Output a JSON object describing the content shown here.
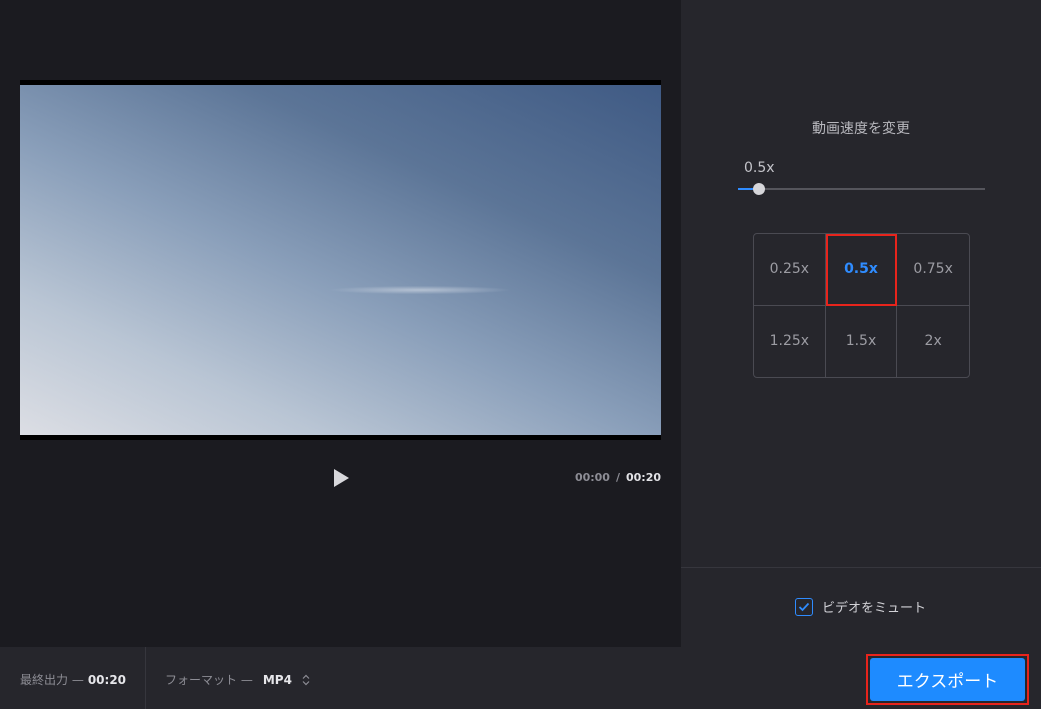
{
  "player": {
    "current_time": "00:00",
    "separator": "/",
    "duration": "00:20",
    "play_icon": "play-icon"
  },
  "speed": {
    "title": "動画速度を変更",
    "slider_value": "0.5x",
    "slider_fraction": 0.085,
    "options": [
      "0.25x",
      "0.5x",
      "0.75x",
      "1.25x",
      "1.5x",
      "2x"
    ],
    "selected": "0.5x"
  },
  "mute": {
    "label": "ビデオをミュート",
    "checked": true,
    "icon": "check-icon"
  },
  "bottom": {
    "output_label": "最終出力 —",
    "output_value": "00:20",
    "format_label": "フォーマット —",
    "format_value": "MP4",
    "format_icon": "chevron-updown-icon",
    "export_label": "エクスポート"
  },
  "colors": {
    "accent": "#2f8cff",
    "highlight": "#e8241c",
    "export_bg": "#1e8bff"
  }
}
